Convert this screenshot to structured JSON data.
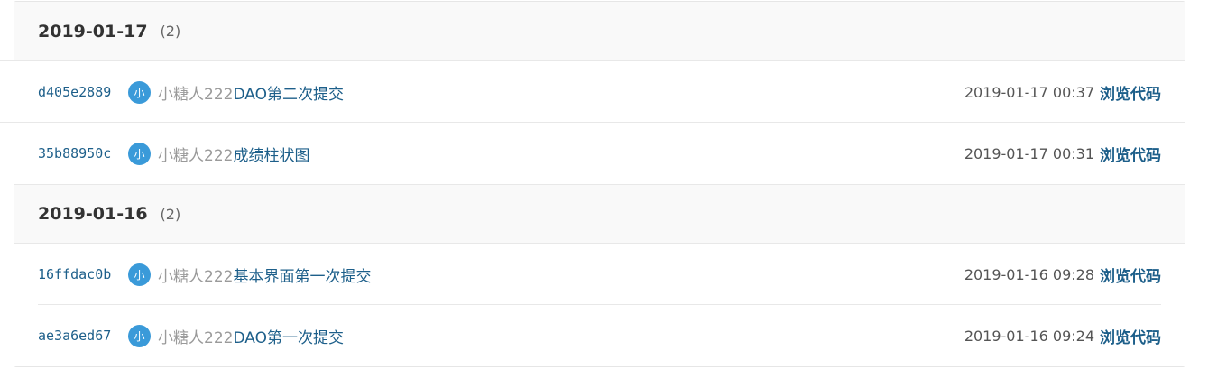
{
  "groups": [
    {
      "date": "2019-01-17",
      "count": "(2)",
      "commits": [
        {
          "sha": "d405e2889",
          "avatar_char": "小",
          "author": "小糖人222",
          "message": "DAO第二次提交",
          "time": "2019-01-17 00:37",
          "browse": "浏览代码"
        },
        {
          "sha": "35b88950c",
          "avatar_char": "小",
          "author": "小糖人222",
          "message": "成绩柱状图",
          "time": "2019-01-17 00:31",
          "browse": "浏览代码"
        }
      ]
    },
    {
      "date": "2019-01-16",
      "count": "(2)",
      "commits": [
        {
          "sha": "16ffdac0b",
          "avatar_char": "小",
          "author": "小糖人222",
          "message": "基本界面第一次提交",
          "time": "2019-01-16 09:28",
          "browse": "浏览代码"
        },
        {
          "sha": "ae3a6ed67",
          "avatar_char": "小",
          "author": "小糖人222",
          "message": "DAO第一次提交",
          "time": "2019-01-16 09:24",
          "browse": "浏览代码"
        }
      ]
    }
  ],
  "colors": {
    "link": "#1d5f8a",
    "avatar": "#3a9ad9",
    "author": "#9a9a9a",
    "header_bg": "#f9f9f9"
  }
}
